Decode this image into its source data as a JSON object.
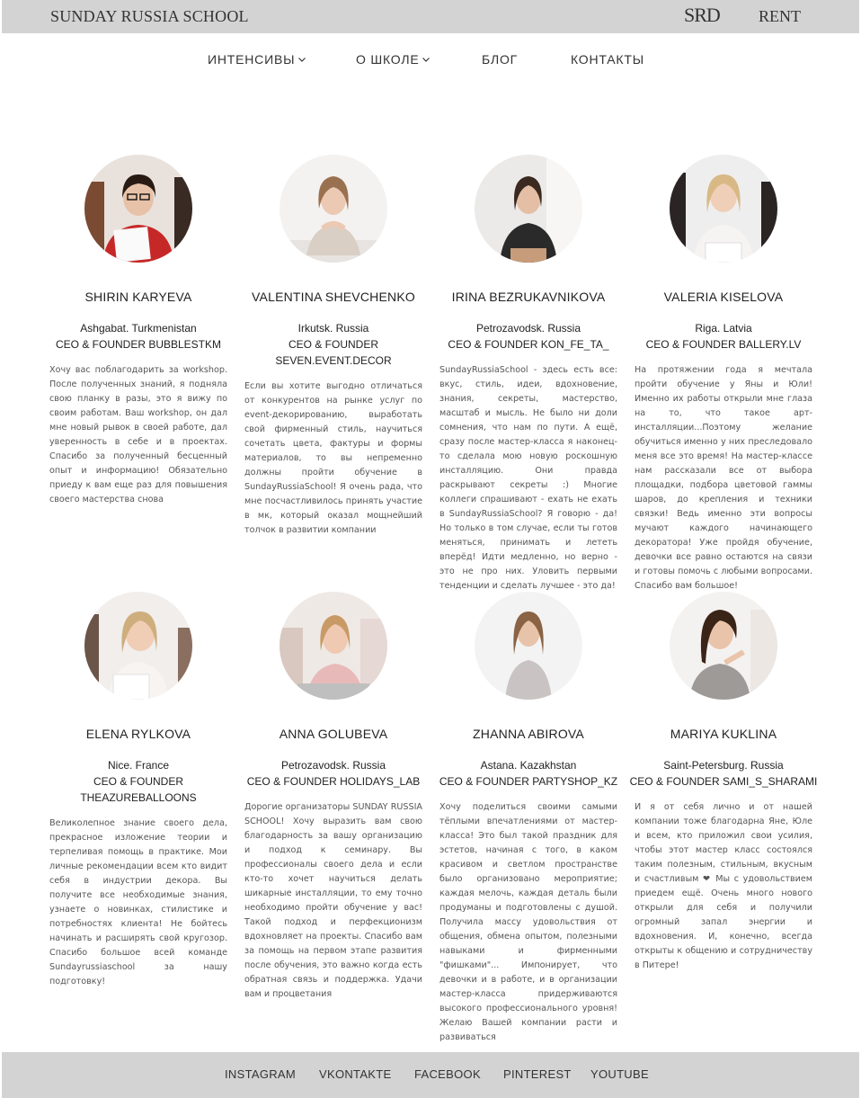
{
  "header": {
    "brand": "SUNDAY RUSSIA SCHOOL",
    "logo_text": "SRD",
    "rent_label": "RENT",
    "bar_color": "#d3d3d3"
  },
  "nav": {
    "items": [
      {
        "label": "ИНТЕНСИВЫ",
        "has_dropdown": true
      },
      {
        "label": "О ШКОЛЕ",
        "has_dropdown": true
      },
      {
        "label": "БЛОГ",
        "has_dropdown": false
      },
      {
        "label": "КОНТАКТЫ",
        "has_dropdown": false
      }
    ]
  },
  "testimonials": [
    {
      "name": "SHIRIN KARYEVA",
      "location": "Ashgabat. Turkmenistan",
      "role": "CEO & FOUNDER BUBBLESTKM",
      "role2": "",
      "photo": "woman-red-jacket-certificate",
      "text": "Хочу вас поблагодарить за workshop. После полученных знаний, я подняла свою планку в разы, это я вижу по своим работам. Ваш workshop, он дал мне новый рывок в своей работе, дал уверенность в себе и в проектах. Спасибо за полученный бесценный опыт и информацию! Обязательно приеду к вам еще раз для повышения своего мастерства снова"
    },
    {
      "name": "VALENTINA SHEVCHENKO",
      "location": "Irkutsk. Russia",
      "role": "CEO & FOUNDER",
      "role2": "SEVEN.EVENT.DECOR",
      "photo": "woman-at-table",
      "text": "Если вы хотите выгодно отличаться от конкурентов на рынке услуг по event-декорированию, выработать свой фирменный стиль, научиться сочетать цвета, фактуры и формы материалов, то вы непременно должны пройти обучение в SundayRussiaSchool! Я очень рада, что мне посчастливилось принять участие в мк, который оказал мощнейший толчок в развитии компании"
    },
    {
      "name": "IRINA BEZRUKAVNIKOVA",
      "location": "Petrozavodsk. Russia",
      "role": "CEO & FOUNDER KON_FE_TA_",
      "role2": "",
      "photo": "woman-dark-jacket",
      "text": "SundayRussiaSchool - здесь есть все: вкус, стиль, идеи, вдохновение, знания, секреты, мастерство, масштаб и мысль. Не было ни доли сомнения, что нам по пути. А ещё, сразу после мастер-класса я наконец-то сделала мою новую роскошную инсталляцию. Они правда раскрывают секреты :) Многие коллеги спрашивают - ехать не ехать в SundayRussiaSchool? Я говорю - да! Но только в том случае, если ты готов меняться, принимать и лететь вперёд! Идти медленно, но верно - это не про них. Уловить первыми тенденции и сделать лучшее - это да!"
    },
    {
      "name": "VALERIA KISELOVA",
      "location": "Riga. Latvia",
      "role": "CEO & FOUNDER BALLERY.LV",
      "role2": "",
      "photo": "blonde-woman-certificate",
      "text": "На протяжении года я мечтала пройти обучение у Яны и Юли! Именно их работы открыли мне глаза на то, что такое арт-инсталляции...Поэтому желание обучиться именно у них преследовало меня все это время! На мастер-классе нам рассказали все от выбора площадки, подбора цветовой гаммы шаров, до крепления и техники связки! Ведь именно эти вопросы мучают каждого начинающего декоратора! Уже пройдя обучение, девочки все равно остаются на связи и готовы помочь с любыми вопросами. Спасибо вам большое!"
    },
    {
      "name": "ELENA RYLKOVA",
      "location": "Nice. France",
      "role": "CEO & FOUNDER",
      "role2": "THEAZUREBALLOONS",
      "photo": "smiling-woman-certificate",
      "text": "Великолепное знание своего дела, прекрасное изложение теории и терпеливая помощь в практике. Мои личные рекомендации всем кто видит себя в индустрии декора. Вы получите все необходимые знания, узнаете о новинках, стилистике и потребностях клиента! Не бойтесь начинать и расширять свой кругозор. Спасибо большое всей команде Sundayrussiaschool за нашу подготовку!"
    },
    {
      "name": "ANNA GOLUBEVA",
      "location": "Petrozavodsk. Russia",
      "role": "CEO & FOUNDER HOLIDAYS_LAB",
      "role2": "",
      "photo": "woman-pink-top-workshop",
      "text": "Дорогие организаторы SUNDAY RUSSIA SCHOOL! Хочу выразить вам свою благодарность за вашу организацию и подход к семинару. Вы профессионалы своего дела и если кто-то хочет научиться делать шикарные инсталляции, то ему точно необходимо пройти обучение у вас! Такой подход и перфекционизм вдохновляет на проекты. Спасибо вам за помощь на первом этапе развития после обучения, это важно когда есть обратная связь и поддержка. Удачи вам и процветания"
    },
    {
      "name": "ZHANNA ABIROVA",
      "location": "Astana. Kazakhstan",
      "role": "CEO & FOUNDER PARTYSHOP_KZ",
      "role2": "",
      "photo": "woman-standing-grey-top",
      "text": "Хочу поделиться своими самыми тёплыми впечатлениями от мастер-класса! Это был такой праздник для эстетов, начиная с того, в каком красивом и светлом пространстве было организовано мероприятие; каждая мелочь, каждая деталь были продуманы и подготовлены с душой. Получила массу удовольствия от общения, обмена опытом, полезными навыками и фирменными \"фишками\"... Импонирует, что девочки и в работе, и в организации мастер-класса придерживаются высокого профессионального уровня! Желаю Вашей компании расти и развиваться"
    },
    {
      "name": "MARIYA KUKLINA",
      "location": "Saint-Petersburg. Russia",
      "role": "CEO & FOUNDER SAMI_S_SHARAMI",
      "role2": "",
      "photo": "woman-dark-hair-smiling",
      "text": "И я от себя лично и от нашей компании тоже благодарна Яне, Юле и всем, кто приложил свои усилия, чтобы этот мастер класс состоялся таким полезным, стильным, вкусным и счастливым ❤ Мы с удовольствием приедем ещё. Очень много нового открыли для себя и получили огромный запал энергии и вдохновения. И, конечно, всегда открыты к общению и сотрудничеству в Питере!"
    }
  ],
  "footer": {
    "links": [
      "INSTAGRAM",
      "VKONTAKTE",
      "FACEBOOK",
      "PINTEREST",
      "YOUTUBE"
    ],
    "bar_color": "#d3d3d3"
  }
}
